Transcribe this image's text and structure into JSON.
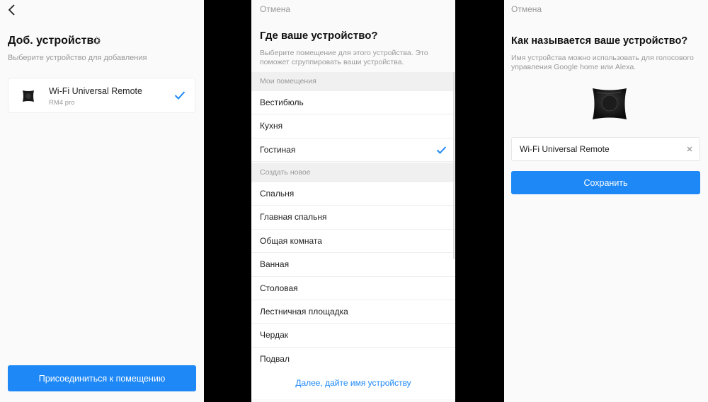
{
  "add_device": {
    "title": "Доб. устройство",
    "subtitle": "Выберите устройство для добавления",
    "device": {
      "name": "Wi-Fi Universal Remote",
      "model": "RM4 pro",
      "selected": true
    },
    "join_button": "Присоединиться к помещению"
  },
  "choose_room": {
    "cancel": "Отмена",
    "title": "Где ваше устройство?",
    "subtitle": "Выберите помещение для этого устройства. Это поможет сгруппировать ваши устройства.",
    "my_rooms_header": "Мои помещения",
    "my_rooms": [
      {
        "label": "Вестибюль",
        "selected": false
      },
      {
        "label": "Кухня",
        "selected": false
      },
      {
        "label": "Гостиная",
        "selected": true
      }
    ],
    "create_new_header": "Создать новое",
    "new_rooms": [
      {
        "label": "Спальня"
      },
      {
        "label": "Главная спальня"
      },
      {
        "label": "Общая комната"
      },
      {
        "label": "Ванная"
      },
      {
        "label": "Столовая"
      },
      {
        "label": "Лестничная площадка"
      },
      {
        "label": "Чердак"
      },
      {
        "label": "Подвал"
      }
    ],
    "next_link": "Далее, дайте имя устройству"
  },
  "name_device": {
    "cancel": "Отмена",
    "title": "Как называется ваше устройство?",
    "subtitle": "Имя устройства можно использовать для голосового управления Google home или Alexa.",
    "input_value": "Wi-Fi Universal Remote",
    "save_button": "Сохранить"
  },
  "colors": {
    "accent": "#1e88f7",
    "background": "#fafafa",
    "divider": "#000000"
  }
}
